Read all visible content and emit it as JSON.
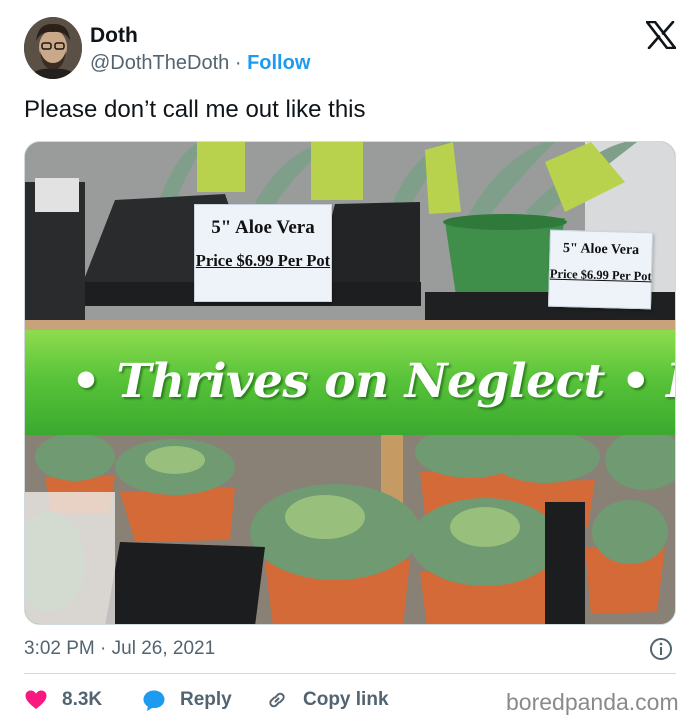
{
  "author": {
    "name": "Doth",
    "handle": "@DothTheDoth",
    "separator": "·",
    "follow_label": "Follow"
  },
  "tweet": {
    "text": "Please don’t call me out like this",
    "timestamp": "3:02 PM · Jul 26, 2021"
  },
  "photo": {
    "sign_left": {
      "size": "5\" Aloe Vera",
      "price": "Price $6.99 Per Pot"
    },
    "sign_right": {
      "size": "5\" Aloe Vera",
      "price": "Price $6.99 Per Pot"
    },
    "banner": "• Thrives on Neglect • Ind"
  },
  "actions": {
    "likes": "8.3K",
    "reply_label": "Reply",
    "copy_label": "Copy link"
  },
  "watermark": "boredpanda.com",
  "colors": {
    "link": "#1d9bf0",
    "like": "#f91880",
    "reply": "#1d9bf0",
    "muted": "#536471",
    "banner": "#59c43a"
  },
  "icons": [
    "x-logo-icon",
    "info-icon",
    "heart-icon",
    "speech-bubble-icon",
    "link-icon"
  ]
}
